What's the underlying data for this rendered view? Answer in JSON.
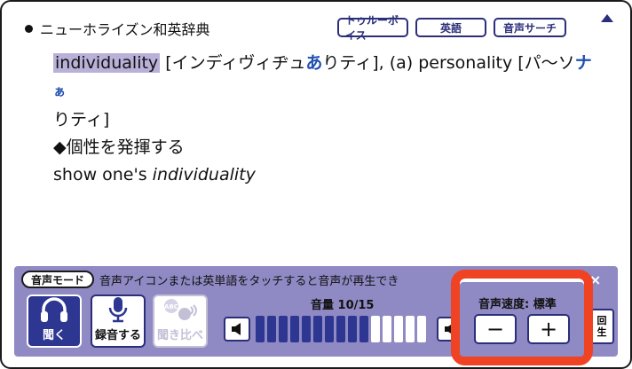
{
  "dictionary": {
    "title": "ニューホライズン和英辞典",
    "buttons": [
      "トゥルーボイス",
      "英語",
      "音声サーチ"
    ]
  },
  "entry": {
    "headword": "individuality",
    "pron1_a": "[インディヴィヂュ",
    "pron1_b": "あ",
    "pron1_c": "りティ],",
    "alt_prefix": "(a) personality [パ〜ソ",
    "alt_b": "ナ",
    "alt_c": "ぁ",
    "alt_line2": "りティ]",
    "sense": "◆個性を発揮する",
    "example_plain": "show one's ",
    "example_italic": "individuality"
  },
  "panel": {
    "mode_label": "音声モード",
    "info_text": "音声アイコンまたは英単語をタッチすると音声が再生でき",
    "close": "×",
    "listen_label": "聞く",
    "record_label": "録音する",
    "compare_label": "聞き比べ",
    "compare_icon_text": "ABC",
    "volume_label": "音量 10/15",
    "volume_level": 10,
    "volume_max": 15,
    "replay_label": [
      "回",
      "生"
    ]
  },
  "speed": {
    "label": "音声速度: 標準",
    "minus": "−",
    "plus": "+"
  },
  "colors": {
    "accent": "#2d3690",
    "panel": "#8f89c4",
    "highlight_ring": "#ef4323",
    "headword_highlight": "#b9b1d8"
  }
}
